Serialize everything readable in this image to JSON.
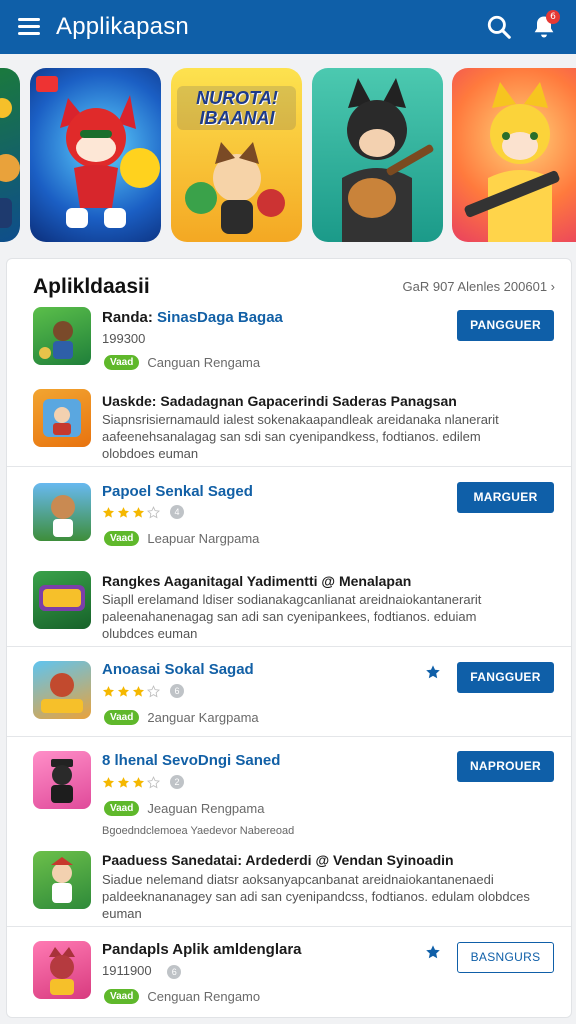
{
  "topbar": {
    "title": "Applikapasn",
    "notification_count": "6"
  },
  "banners": [
    {
      "name": "banner-1",
      "text": ""
    },
    {
      "name": "banner-2",
      "text": ""
    },
    {
      "name": "banner-3",
      "text": "NUROTA! IBAANAI"
    },
    {
      "name": "banner-4",
      "text": ""
    },
    {
      "name": "banner-5",
      "text": ""
    }
  ],
  "section": {
    "title": "Aplikldaasii",
    "meta": "GaR 907 Alenles 200601 ›"
  },
  "apps": [
    {
      "title_prefix": "Randa:",
      "title_rest": "SinasDaga Bagaa",
      "line2": "199300",
      "tag": "Vaad",
      "tag_text": "Canguan Rengama",
      "button": "PANGGUER"
    },
    {
      "title": "Uaskde: Sadadagnan Gapacerindi Saderas Panagsan",
      "desc": "Siapnsrisiernamauld ialest sokenakaapandleak areidanaka nlanerarit aafeenehsanalagag san sdi san cyenipandkess, fodtianos. edilem olobdoes euman"
    },
    {
      "title": "Papoel Senkal Saged",
      "rating": 3,
      "rating_count": "4",
      "tag": "Vaad",
      "tag_text": "Leapuar Nargpama",
      "button": "MARGUER"
    },
    {
      "title": "Rangkes Aaganitagal Yadimentti @ Menalapan",
      "desc": "Siapll erelamand ldiser sodianakagcanlianat areidnaiokantanerarit paleenahanenagag san adi san cyenipankees, fodtianos. eduiam olubdces euman"
    },
    {
      "title": "Anoasai Sokal Sagad",
      "rating": 3,
      "rating_count": "6",
      "tag": "Vaad",
      "tag_text": "2anguar Kargpama",
      "button": "FANGGUER"
    },
    {
      "title": "8 lhenal SevoDngi Saned",
      "rating": 3,
      "rating_count": "2",
      "tag": "Vaad",
      "tag_text": "Jeaguan Rengpama",
      "note": "Bgoedndclemoea Yaedevor Nabereoad",
      "button": "NAPROUER"
    },
    {
      "title": "Paaduess Sanedatai: Ardederdi @ Vendan Syinoadin",
      "desc": "Siadue nelemand diatsr aoksanyapcanbanat areidnaiokantanenaedi paldeeknananagey san adi san cyenipandcss, fodtianos. edulam olobdces euman"
    },
    {
      "title": "Pandapls Aplik amldenglara",
      "line2": "1911900",
      "rating_count": "6",
      "tag": "Vaad",
      "tag_text": "Cenguan Rengamo",
      "button": "BASNGURS"
    }
  ],
  "colors": {
    "primary": "#0f5fa8",
    "tag_green": "#5fb82b",
    "star": "#f5b800"
  }
}
